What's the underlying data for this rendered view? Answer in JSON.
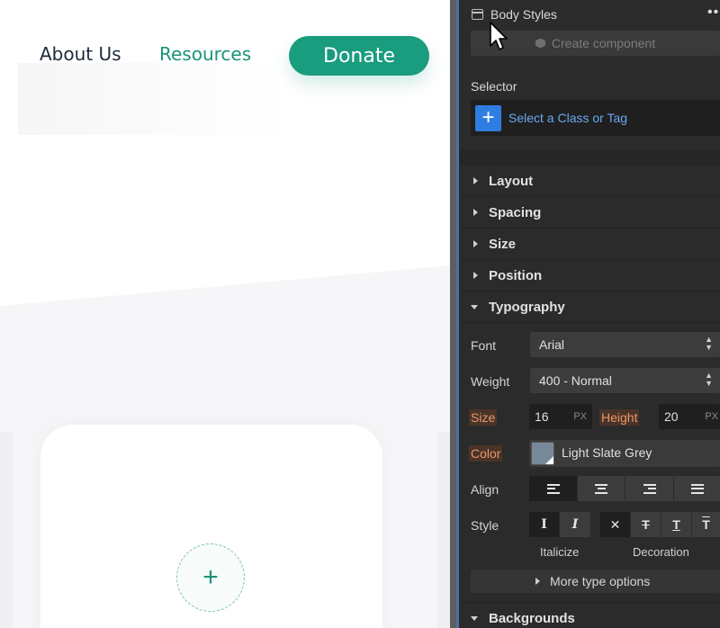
{
  "canvas": {
    "nav": {
      "about": "About Us",
      "resources": "Resources"
    },
    "donate_label": "Donate",
    "card_add_glyph": "+"
  },
  "panel": {
    "title": "Body Styles",
    "more_glyph": "•••",
    "create_component": "Create component",
    "selector": {
      "label": "Selector",
      "placeholder": "Select a Class or Tag",
      "add_glyph": "+"
    },
    "sections": [
      "Layout",
      "Spacing",
      "Size",
      "Position",
      "Typography",
      "Backgrounds"
    ],
    "typography": {
      "font_label": "Font",
      "font_value": "Arial",
      "weight_label": "Weight",
      "weight_value": "400 - Normal",
      "size_label": "Size",
      "size_value": "16",
      "size_unit": "PX",
      "height_label": "Height",
      "height_value": "20",
      "height_unit": "PX",
      "color_label": "Color",
      "color_name": "Light Slate Grey",
      "color_hex": "#778899",
      "align_label": "Align",
      "style_label": "Style",
      "style_italic_glyph": "I",
      "style_italic_active_glyph": "I",
      "decoration_none_glyph": "✕",
      "italicize_label": "Italicize",
      "decoration_label": "Decoration",
      "more_options": "More type options"
    }
  },
  "colors": {
    "brand_green": "#1a9c7e",
    "panel_bg": "#2b2b2b",
    "accent_blue": "#2f7de1",
    "set_orange": "#e8976a"
  }
}
